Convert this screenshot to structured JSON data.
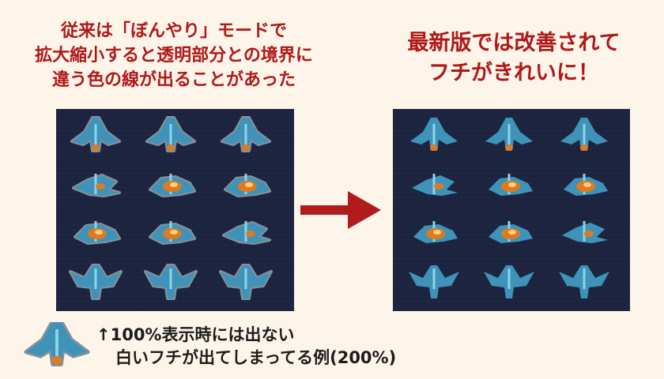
{
  "left_caption": {
    "line1": "従来は「ぼんやり」モードで",
    "line2": "拡大縮小すると透明部分との境界に",
    "line3": "違う色の線が出ることがあった"
  },
  "right_caption": {
    "line1": "最新版では改善されて",
    "line2": "フチがきれいに！"
  },
  "bottom_note": {
    "line1": "↑100%表示時には出ない",
    "line2": "白いフチが出てしまってる例(200%)"
  },
  "colors": {
    "caption_red": "#b01818",
    "arrow_red": "#b01c1c",
    "background": "#fdf5ea",
    "panel_bg": "#1c2440",
    "bird_blue": "#3f93b8",
    "bird_light": "#8cd4ea",
    "bird_orange": "#e07a20",
    "halo_gray": "#8a8f99"
  },
  "sprites": {
    "before_panel": "bird-sprite-sheet-with-light-fringe",
    "after_panel": "bird-sprite-sheet-clean-edges",
    "example": "bird-sprite-enlarged-200-percent"
  }
}
